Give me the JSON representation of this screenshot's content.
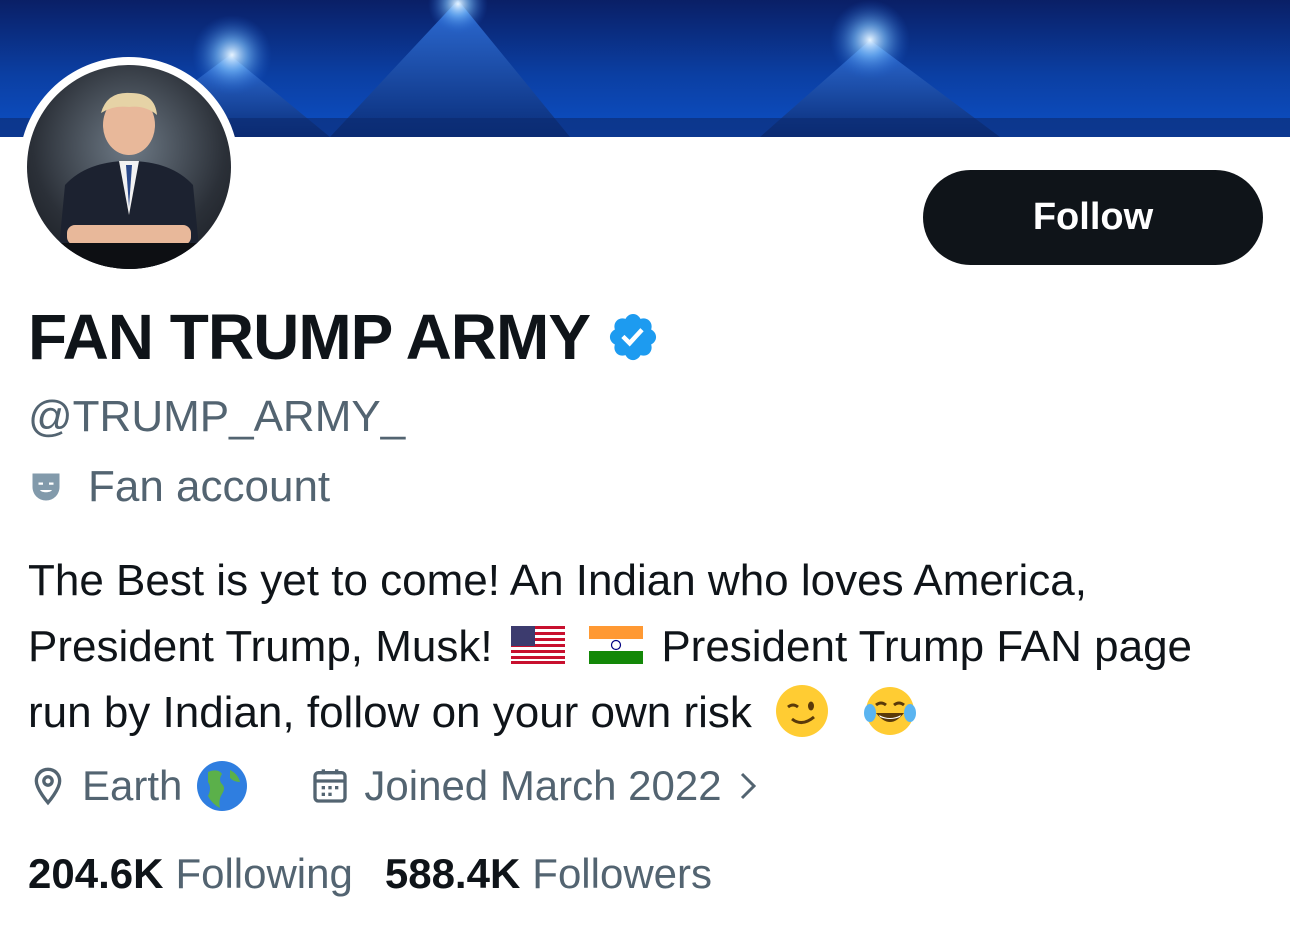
{
  "profile": {
    "display_name": "FAN TRUMP ARMY",
    "handle": "@TRUMP_ARMY_",
    "label": "Fan account",
    "bio_line1": "The Best is yet to come! An Indian who loves America,",
    "bio_line2_a": "President Trump, Musk!",
    "bio_line2_b": "President Trump FAN page",
    "bio_line3": "run by Indian, follow on your own risk",
    "location": "Earth",
    "joined": "Joined March 2022"
  },
  "actions": {
    "follow_label": "Follow"
  },
  "stats": {
    "following_count": "204.6K",
    "following_label": "Following",
    "followers_count": "588.4K",
    "followers_label": "Followers"
  },
  "icons": {
    "verified": "verified-badge-icon",
    "label": "theater-mask-icon",
    "location": "location-pin-icon",
    "calendar": "calendar-icon",
    "chevron": "chevron-right-icon",
    "flags": [
      "us-flag-icon",
      "india-flag-icon"
    ],
    "emojis": [
      "winking-face-icon",
      "tears-of-joy-icon",
      "globe-americas-icon"
    ]
  },
  "colors": {
    "primary_text": "#0f1419",
    "secondary_text": "#536471",
    "verified_blue": "#1d9bf0",
    "button_bg": "#0f1419"
  }
}
